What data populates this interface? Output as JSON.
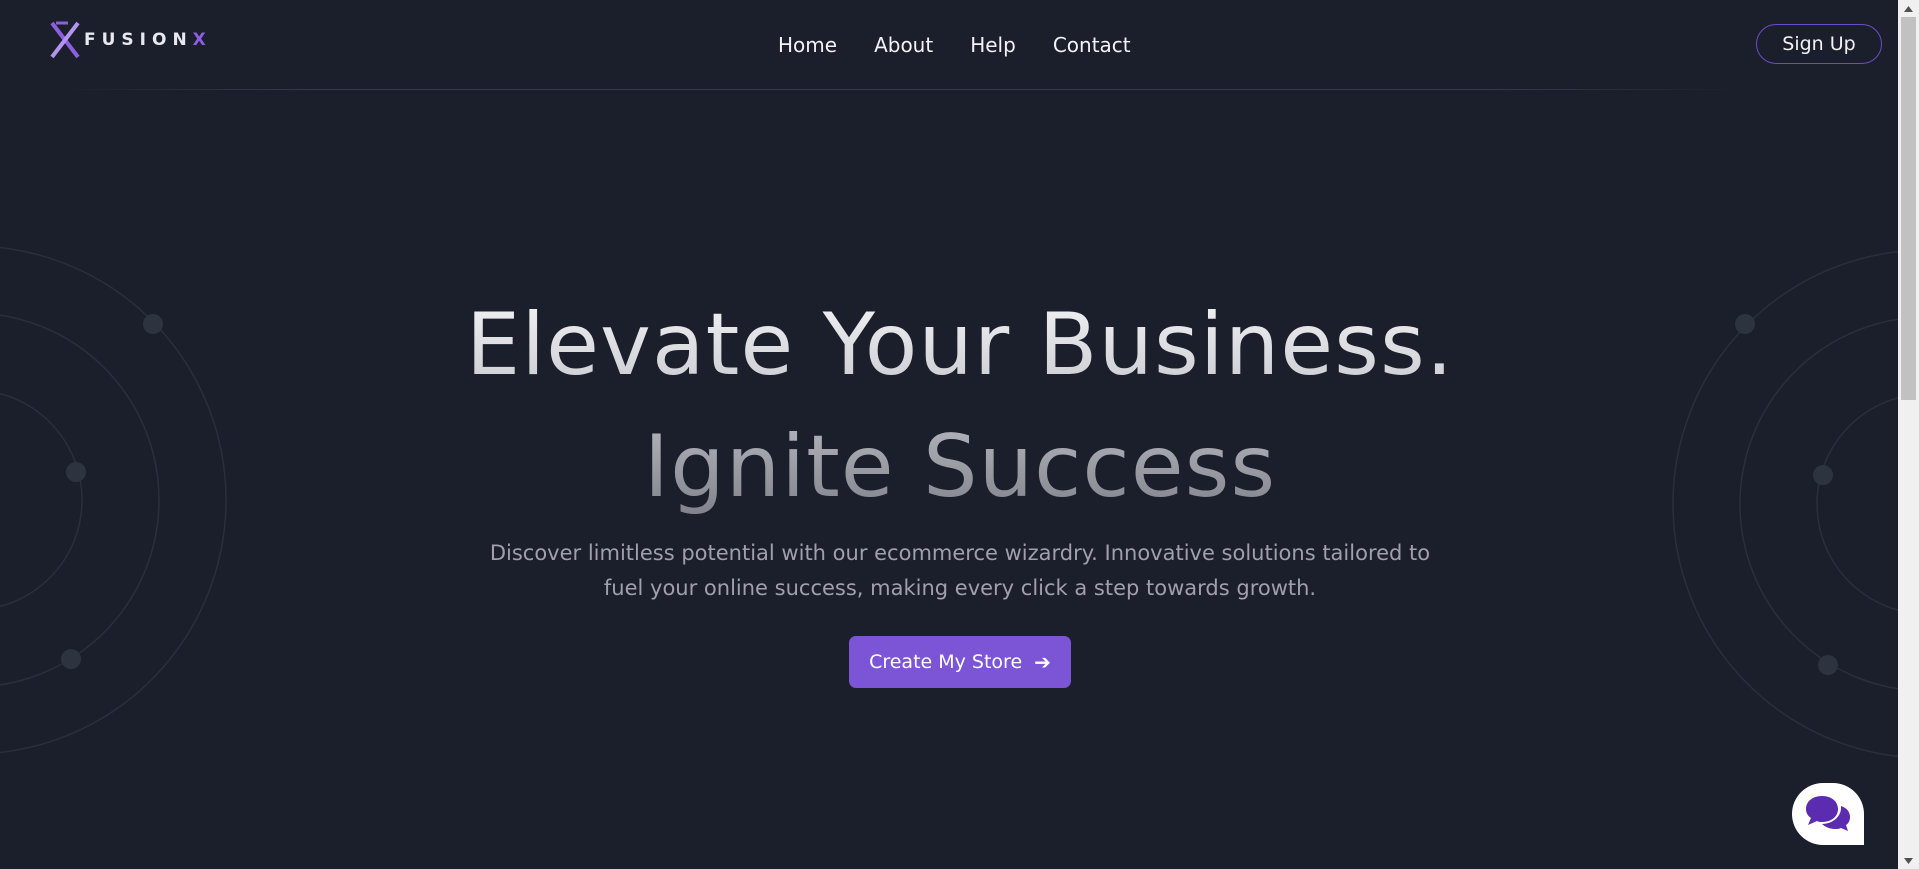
{
  "brand": {
    "logo_text": "FUSION",
    "logo_x": "X",
    "accent_color": "#7c55d6"
  },
  "nav": {
    "items": [
      {
        "label": "Home"
      },
      {
        "label": "About"
      },
      {
        "label": "Help"
      },
      {
        "label": "Contact"
      }
    ],
    "signup_label": "Sign Up"
  },
  "hero": {
    "title": "Elevate Your Business.",
    "subtitle": "Ignite Success",
    "description": "Discover limitless potential with our ecommerce wizardry. Innovative solutions tailored to fuel your online success, making every click a step towards growth.",
    "cta_label": "Create My Store",
    "cta_icon": "arrow-right-icon"
  },
  "chat": {
    "icon": "chat-bubbles-icon"
  },
  "colors": {
    "background": "#1b1f2b",
    "button": "#7c55d6",
    "signup_border": "#6c4bc9",
    "chat_icon": "#5b2bb0"
  }
}
